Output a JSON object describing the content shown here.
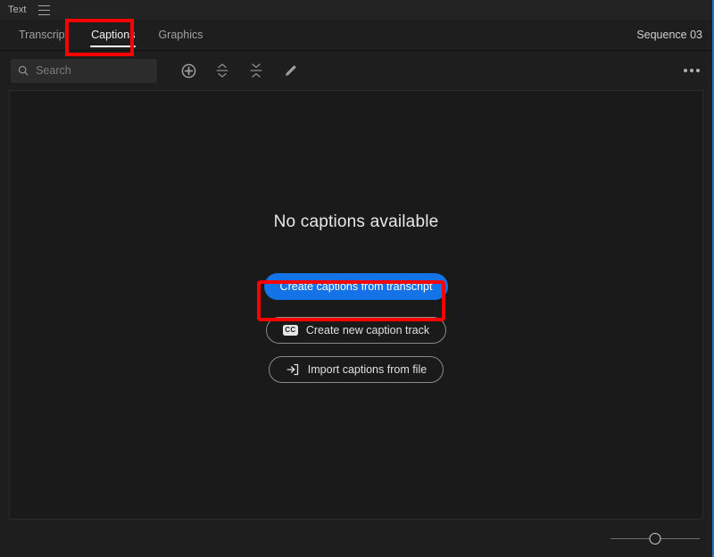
{
  "panel": {
    "title": "Text",
    "menu_icon": "hamburger-icon"
  },
  "tabs": {
    "items": [
      {
        "label": "Transcript",
        "active": false
      },
      {
        "label": "Captions",
        "active": true
      },
      {
        "label": "Graphics",
        "active": false
      }
    ],
    "sequence_label": "Sequence 03"
  },
  "toolbar": {
    "search": {
      "placeholder": "Search",
      "value": "",
      "icon": "search-icon"
    },
    "buttons": [
      {
        "name": "add-caption-button",
        "icon": "plus-circle-icon"
      },
      {
        "name": "split-caption-button",
        "icon": "split-arrows-icon"
      },
      {
        "name": "merge-caption-button",
        "icon": "merge-arrows-icon"
      },
      {
        "name": "edit-caption-button",
        "icon": "pencil-icon"
      }
    ],
    "overflow": {
      "label": "More options",
      "icon": "ellipsis-icon"
    }
  },
  "empty_state": {
    "title": "No captions available",
    "actions": [
      {
        "label": "Create captions from transcript",
        "style": "primary",
        "icon": null
      },
      {
        "label": "Create new caption track",
        "style": "secondary",
        "icon": "cc-icon",
        "icon_text": "CC"
      },
      {
        "label": "Import captions from file",
        "style": "secondary",
        "icon": "import-arrow-icon"
      }
    ]
  },
  "footer": {
    "zoom_slider": {
      "name": "caption-size-slider",
      "value": 50,
      "min": 0,
      "max": 100
    }
  },
  "annotations": [
    {
      "name": "annotation-captions-tab",
      "color": "#fe0000",
      "target": "Captions tab"
    },
    {
      "name": "annotation-create-captions-button",
      "color": "#fe0000",
      "target": "Create captions from transcript"
    }
  ],
  "colors": {
    "accent_blue": "#1473e6",
    "focus_edge": "#2d6fc4",
    "annotation_red": "#fe0000",
    "panel_bg": "#1e1e1e",
    "content_bg": "#1a1a1a"
  }
}
